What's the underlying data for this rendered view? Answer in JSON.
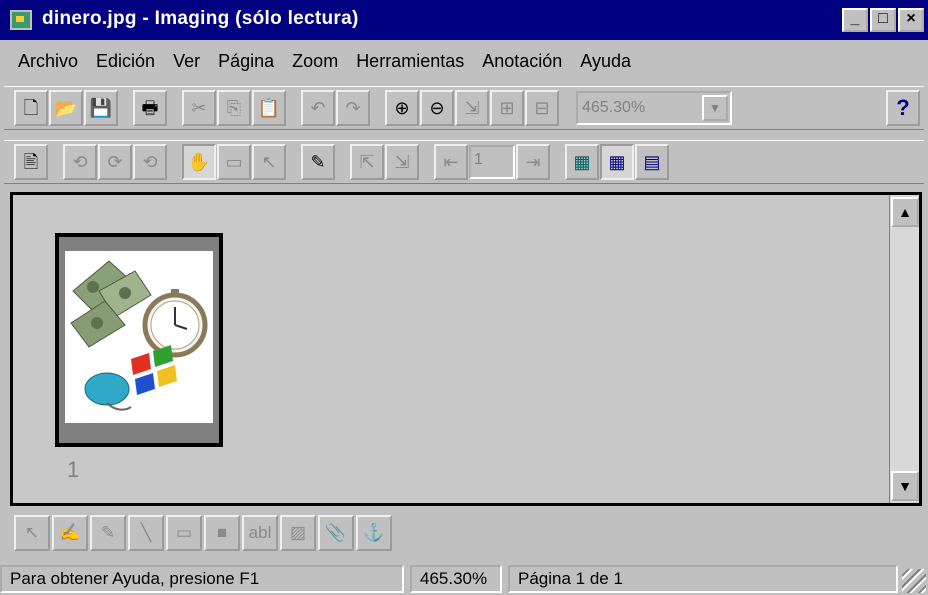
{
  "window": {
    "title": "dinero.jpg - Imaging (sólo lectura)",
    "minimize": "_",
    "maximize": "□",
    "close": "×"
  },
  "menu": [
    "Archivo",
    "Edición",
    "Ver",
    "Página",
    "Zoom",
    "Herramientas",
    "Anotación",
    "Ayuda"
  ],
  "toolbar1": {
    "new_icon": "🗋",
    "open_icon": "📂",
    "save_icon": "💾",
    "print_icon": "🖶",
    "cut_icon": "✂",
    "copy_icon": "⎘",
    "paste_icon": "📋",
    "undo_icon": "↶",
    "redo_icon": "↷",
    "zoom_in_icon": "⊕",
    "zoom_out_icon": "⊖",
    "fit_icon": "⇲",
    "best_fit_icon": "⊞",
    "fit_width_icon": "⊟",
    "zoom_value": "465.30%",
    "dropdown_icon": "▼",
    "help_label": "?"
  },
  "toolbar2": {
    "scan_icon": "🖹",
    "rotate_icons": [
      "⟲",
      "⟳",
      "⟲"
    ],
    "hand_icon": "✋",
    "select_icon": "▭",
    "pointer_icon": "↖",
    "annotate_icon": "✎",
    "page_prev_icons": [
      "⇱",
      "⇲"
    ],
    "first_page_icon": "⇤",
    "page_value": "1",
    "last_page_icon": "⇥",
    "view_icons": [
      "▦",
      "▦",
      "▤"
    ]
  },
  "bottom_toolbar": [
    "↖",
    "✍",
    "✎",
    "╲",
    "▭",
    "■",
    "abl",
    "▨",
    "📎",
    "⚓"
  ],
  "workspace": {
    "page_number": "1",
    "scroll_up": "▲",
    "scroll_down": "▼"
  },
  "status": {
    "help_text": "Para obtener Ayuda, presione F1",
    "zoom": "465.30%",
    "page": "Página 1 de 1"
  }
}
